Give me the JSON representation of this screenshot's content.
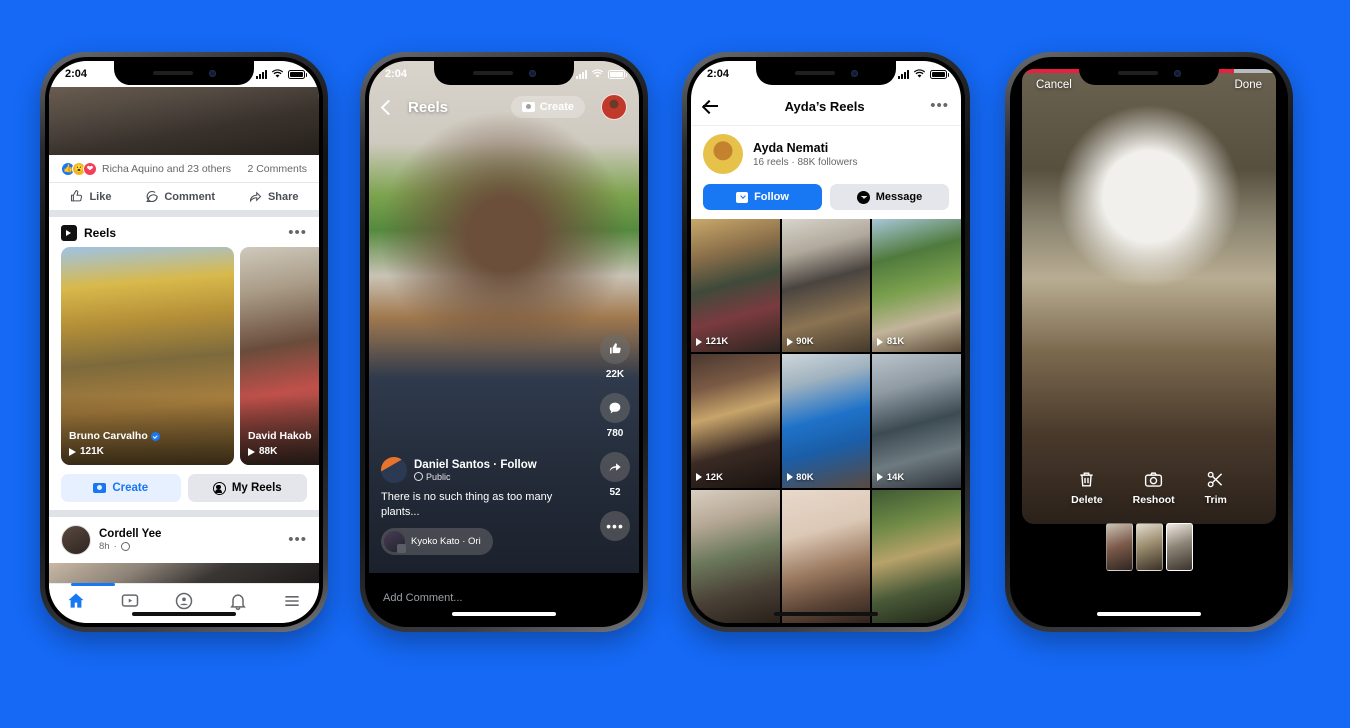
{
  "background_color": "#1569f5",
  "phones": {
    "feed": {
      "status": {
        "time": "2:04"
      },
      "post_above": {
        "reactions_summary": "Richa Aquino and 23 others",
        "comments": "2 Comments",
        "actions": [
          {
            "label": "Like",
            "icon": "thumbs-up-icon"
          },
          {
            "label": "Comment",
            "icon": "comment-bubble-icon"
          },
          {
            "label": "Share",
            "icon": "share-arrow-icon"
          }
        ]
      },
      "reels_unit": {
        "title": "Reels",
        "menu_icon": "overflow-dots-icon",
        "cards": [
          {
            "name": "Bruno Carvalho",
            "verified": true,
            "plays": "121K"
          },
          {
            "name": "David Hakob",
            "verified": false,
            "plays": "88K"
          }
        ],
        "buttons": [
          {
            "label": "Create",
            "icon": "camera-icon",
            "style": "primary"
          },
          {
            "label": "My Reels",
            "icon": "person-circle-icon",
            "style": "secondary"
          }
        ]
      },
      "next_post": {
        "author": "Cordell Yee",
        "time": "8h",
        "privacy_icon": "globe-icon",
        "menu_icon": "overflow-dots-icon"
      },
      "tabbar": [
        {
          "name": "home",
          "icon": "home-icon",
          "active": true
        },
        {
          "name": "watch",
          "icon": "video-play-icon",
          "active": false
        },
        {
          "name": "groups",
          "icon": "groups-icon",
          "active": false
        },
        {
          "name": "notifications",
          "icon": "bell-icon",
          "active": false
        },
        {
          "name": "menu",
          "icon": "hamburger-menu-icon",
          "active": false
        }
      ],
      "accent_color": "#1877f2"
    },
    "viewer": {
      "status": {
        "time": "2:04"
      },
      "header": {
        "back_icon": "chevron-left-icon",
        "title": "Reels",
        "create_label": "Create",
        "create_icon": "camera-icon",
        "avatar": "profile-avatar"
      },
      "actions": [
        {
          "name": "like",
          "icon": "thumbs-up-icon",
          "count": "22K"
        },
        {
          "name": "comment",
          "icon": "comment-bubble-icon",
          "count": "780"
        },
        {
          "name": "share",
          "icon": "share-arrow-icon",
          "count": "52"
        },
        {
          "name": "more",
          "icon": "overflow-dots-icon",
          "count": ""
        }
      ],
      "info": {
        "author": "Daniel Santos",
        "follow_label": "Follow",
        "separator": "·",
        "privacy": "Public",
        "privacy_icon": "globe-icon",
        "caption": "There is no such thing as too many plants...",
        "audio": "Kyoko Kato · Ori"
      },
      "comment_placeholder": "Add Comment..."
    },
    "profile": {
      "status": {
        "time": "2:04"
      },
      "header": {
        "back_icon": "arrow-left-icon",
        "title": "Ayda’s Reels",
        "menu_icon": "overflow-dots-icon"
      },
      "user": {
        "name": "Ayda Nemati",
        "stats": "16 reels · 88K followers",
        "avatar": "profile-avatar"
      },
      "buttons": [
        {
          "label": "Follow",
          "icon": "follow-plus-icon",
          "style": "primary"
        },
        {
          "label": "Message",
          "icon": "messenger-icon",
          "style": "secondary"
        }
      ],
      "grid": [
        {
          "plays": "121K",
          "bg": "linear-gradient(165deg,#c9a96b 0%,#8b6f4a 26%,#3f4a3a 48%,#7a3b3f 70%,#2c2620 100%)"
        },
        {
          "plays": "90K",
          "bg": "linear-gradient(165deg,#d8d4cc 0%,#b0a99c 24%,#4a4440 46%,#8a7352 72%,#45392c 100%)"
        },
        {
          "plays": "81K",
          "bg": "linear-gradient(165deg,#a7c7d8 0%,#4f7a3d 28%,#7ba04e 52%,#c2b49a 74%,#5c4b38 100%)"
        },
        {
          "plays": "12K",
          "bg": "linear-gradient(165deg,#4a3830 0%,#7a5a44 24%,#c7a46a 44%,#3a2a24 70%,#19120f 100%)"
        },
        {
          "plays": "80K",
          "bg": "linear-gradient(165deg,#cfd6da 0%,#9fb2bf 22%,#1f72c9 48%,#1a5ea8 68%,#5a4a40 100%)"
        },
        {
          "plays": "14K",
          "bg": "linear-gradient(165deg,#b9c4cb 0%,#8f9aa3 26%,#3c4a52 52%,#6d7a80 74%,#2b3237 100%)"
        },
        {
          "plays": "",
          "bg": "linear-gradient(165deg,#d8cfc0 0%,#b7a896 24%,#6c7a5c 48%,#4a4036 74%,#272019 100%)"
        },
        {
          "plays": "",
          "bg": "linear-gradient(165deg,#e8d9cb 0%,#dcc8b6 32%,#9b7a60 58%,#5c4436 80%,#2f231c 100%)"
        },
        {
          "plays": "",
          "bg": "linear-gradient(165deg,#3f5a33 0%,#6f8a46 26%,#b7a26a 48%,#4a5a38 72%,#1e2417 100%)"
        }
      ]
    },
    "editor": {
      "cancel_label": "Cancel",
      "done_label": "Done",
      "progress": {
        "recorded_color": "#e81f3e",
        "remaining_color": "#b9bcc0",
        "segments": [
          36,
          34,
          12
        ],
        "remaining": 18
      },
      "tools": [
        {
          "label": "Delete",
          "icon": "trash-icon"
        },
        {
          "label": "Reshoot",
          "icon": "camera-icon"
        },
        {
          "label": "Trim",
          "icon": "scissors-icon"
        }
      ],
      "clips": [
        {
          "selected": false,
          "bg": "linear-gradient(160deg,#c9c2b4,#7d5a4a 48%,#2e2622)"
        },
        {
          "selected": false,
          "bg": "linear-gradient(160deg,#e2dbcd,#9a8b6e 46%,#3b3226)"
        },
        {
          "selected": true,
          "bg": "linear-gradient(160deg,#efeae2,#8d8578 46%,#3a332b)"
        }
      ]
    }
  }
}
